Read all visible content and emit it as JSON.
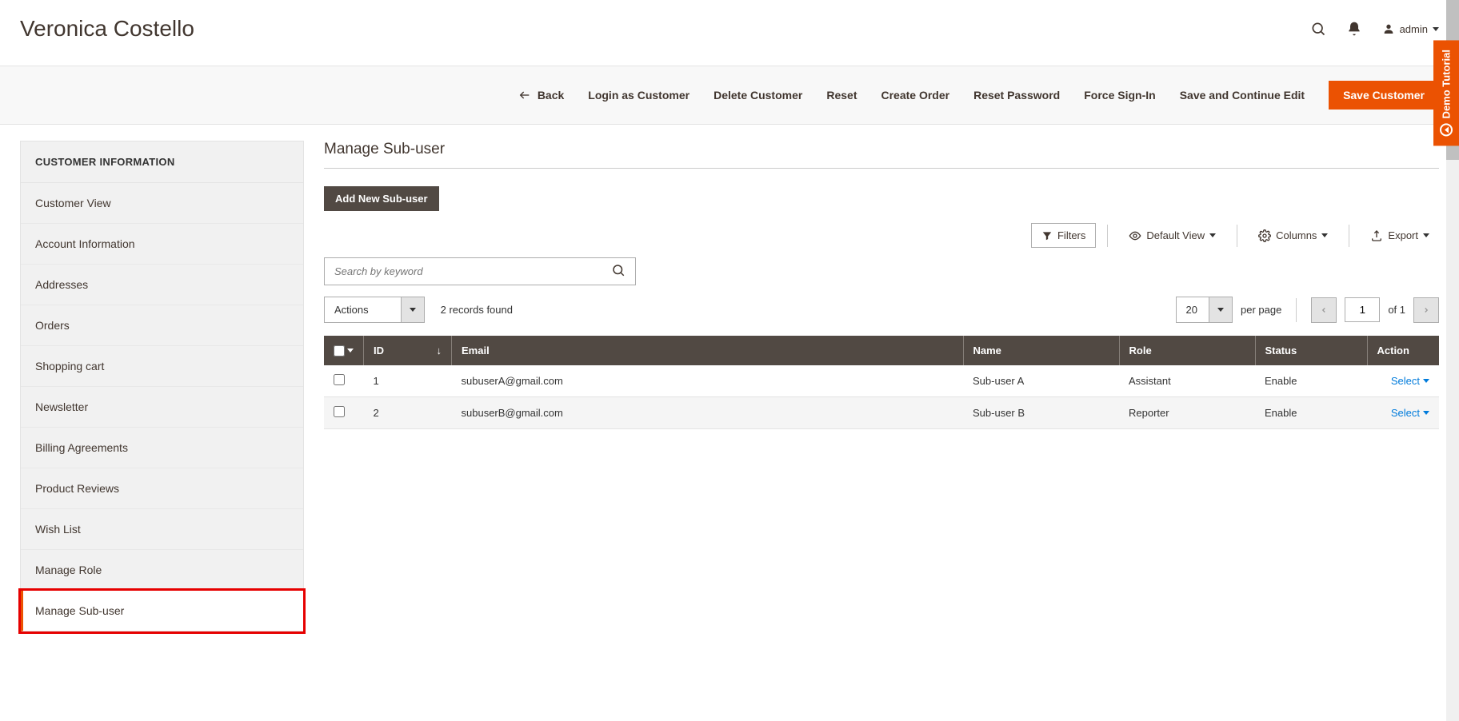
{
  "header": {
    "title": "Veronica Costello",
    "admin_label": "admin"
  },
  "toolbar": {
    "back": "Back",
    "login_as_customer": "Login as Customer",
    "delete_customer": "Delete Customer",
    "reset": "Reset",
    "create_order": "Create Order",
    "reset_password": "Reset Password",
    "force_signin": "Force Sign-In",
    "save_continue": "Save and Continue Edit",
    "save_customer": "Save Customer"
  },
  "sidebar": {
    "header": "CUSTOMER INFORMATION",
    "items": [
      {
        "label": "Customer View"
      },
      {
        "label": "Account Information"
      },
      {
        "label": "Addresses"
      },
      {
        "label": "Orders"
      },
      {
        "label": "Shopping cart"
      },
      {
        "label": "Newsletter"
      },
      {
        "label": "Billing Agreements"
      },
      {
        "label": "Product Reviews"
      },
      {
        "label": "Wish List"
      },
      {
        "label": "Manage Role"
      },
      {
        "label": "Manage Sub-user"
      }
    ],
    "active_index": 10
  },
  "main": {
    "section_title": "Manage Sub-user",
    "add_button": "Add New Sub-user",
    "controls": {
      "filters": "Filters",
      "default_view": "Default View",
      "columns": "Columns",
      "export": "Export"
    },
    "search_placeholder": "Search by keyword",
    "actions": {
      "label": "Actions",
      "records_found": "2 records found",
      "per_page_value": "20",
      "per_page_label": "per page",
      "current_page": "1",
      "of_label": "of 1"
    },
    "table": {
      "columns": [
        "ID",
        "Email",
        "Name",
        "Role",
        "Status",
        "Action"
      ],
      "rows": [
        {
          "id": "1",
          "email": "subuserA@gmail.com",
          "name": "Sub-user A",
          "role": "Assistant",
          "status": "Enable",
          "action": "Select"
        },
        {
          "id": "2",
          "email": "subuserB@gmail.com",
          "name": "Sub-user B",
          "role": "Reporter",
          "status": "Enable",
          "action": "Select"
        }
      ]
    }
  },
  "demo_tab": "Demo Tutorial"
}
